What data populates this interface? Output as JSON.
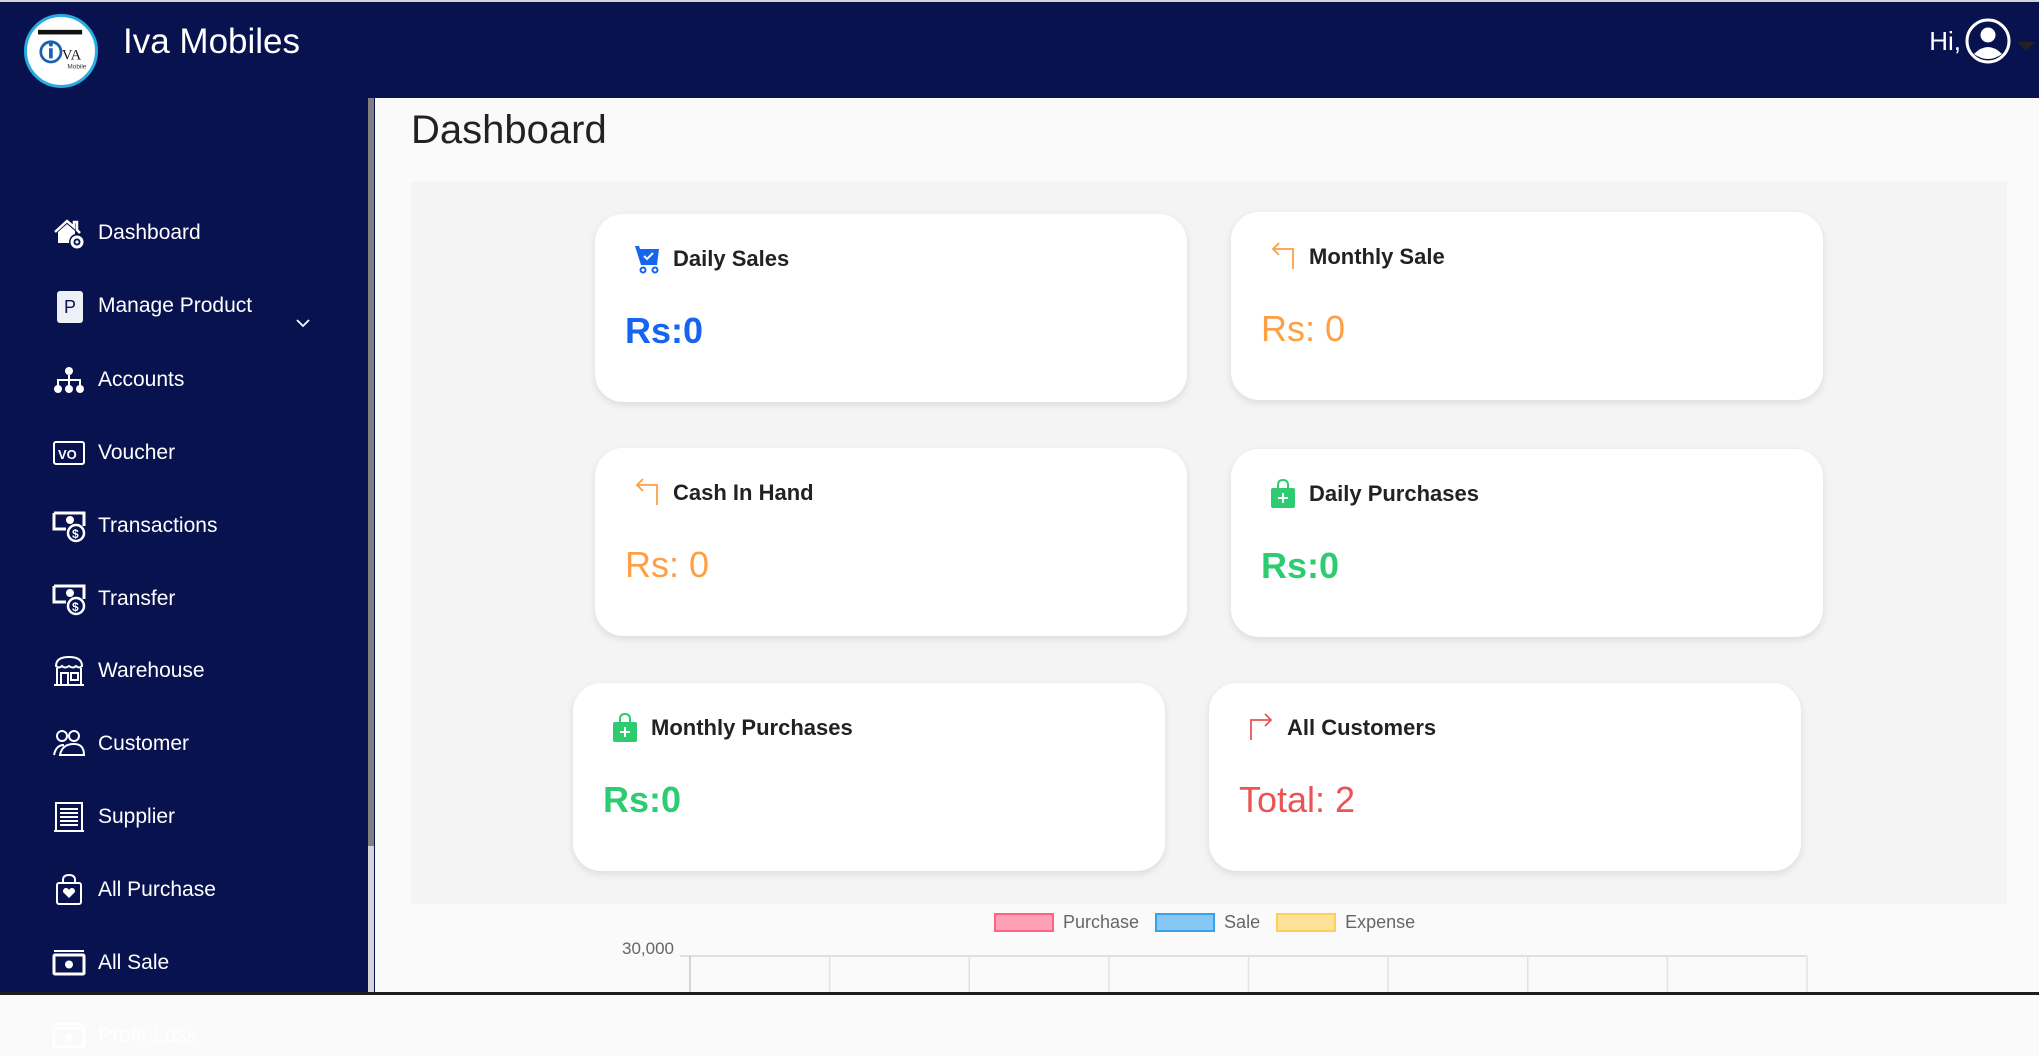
{
  "header": {
    "app_title": "Iva Mobiles",
    "logo_alt": "IVA Mobile",
    "greeting": "Hi,"
  },
  "sidebar": {
    "items": [
      {
        "label": "Dashboard",
        "icon": "home-gear-icon"
      },
      {
        "label": "Manage Product",
        "icon": "product-p-icon",
        "expandable": true
      },
      {
        "label": "Accounts",
        "icon": "sitemap-icon"
      },
      {
        "label": "Voucher",
        "icon": "voucher-icon"
      },
      {
        "label": "Transactions",
        "icon": "money-dollar-icon"
      },
      {
        "label": "Transfer",
        "icon": "money-dollar-icon"
      },
      {
        "label": "Warehouse",
        "icon": "store-icon"
      },
      {
        "label": "Customer",
        "icon": "users-icon"
      },
      {
        "label": "Supplier",
        "icon": "receipt-list-icon"
      },
      {
        "label": "All Purchase",
        "icon": "bag-heart-icon"
      },
      {
        "label": "All Sale",
        "icon": "cash-icon"
      },
      {
        "label": "Profit Loss",
        "icon": "cash-icon"
      }
    ]
  },
  "main": {
    "page_title": "Dashboard",
    "cards": [
      {
        "title": "Daily Sales",
        "value": "Rs:0",
        "icon": "cart-check-icon",
        "color": "#1565f0"
      },
      {
        "title": "Monthly Sale",
        "value": "Rs: 0",
        "icon": "arrow-return-left-icon",
        "color": "#ff9f43"
      },
      {
        "title": "Cash In Hand",
        "value": "Rs: 0",
        "icon": "arrow-return-left-icon",
        "color": "#ff9f43"
      },
      {
        "title": "Daily Purchases",
        "value": "Rs:0",
        "icon": "bag-plus-icon",
        "color": "#2ecc71"
      },
      {
        "title": "Monthly Purchases",
        "value": "Rs:0",
        "icon": "bag-plus-icon",
        "color": "#2ecc71"
      },
      {
        "title": "All Customers",
        "value": "Total: 2",
        "icon": "arrow-return-right-icon",
        "color": "#ea5455"
      }
    ]
  },
  "chart_data": {
    "type": "bar",
    "title": "",
    "legend": [
      {
        "name": "Purchase",
        "fill": "#ffa1b5",
        "border": "#ff6384"
      },
      {
        "name": "Sale",
        "fill": "#86c7f3",
        "border": "#36a2eb"
      },
      {
        "name": "Expense",
        "fill": "#ffe29a",
        "border": "#ffce56"
      }
    ],
    "legend_position": "top-center",
    "y_ticks_visible": [
      "30,000"
    ],
    "ylim_top": 30000,
    "category_count": 8,
    "series": [
      {
        "name": "Purchase",
        "values": []
      },
      {
        "name": "Sale",
        "values": []
      },
      {
        "name": "Expense",
        "values": []
      }
    ],
    "grid": true
  }
}
